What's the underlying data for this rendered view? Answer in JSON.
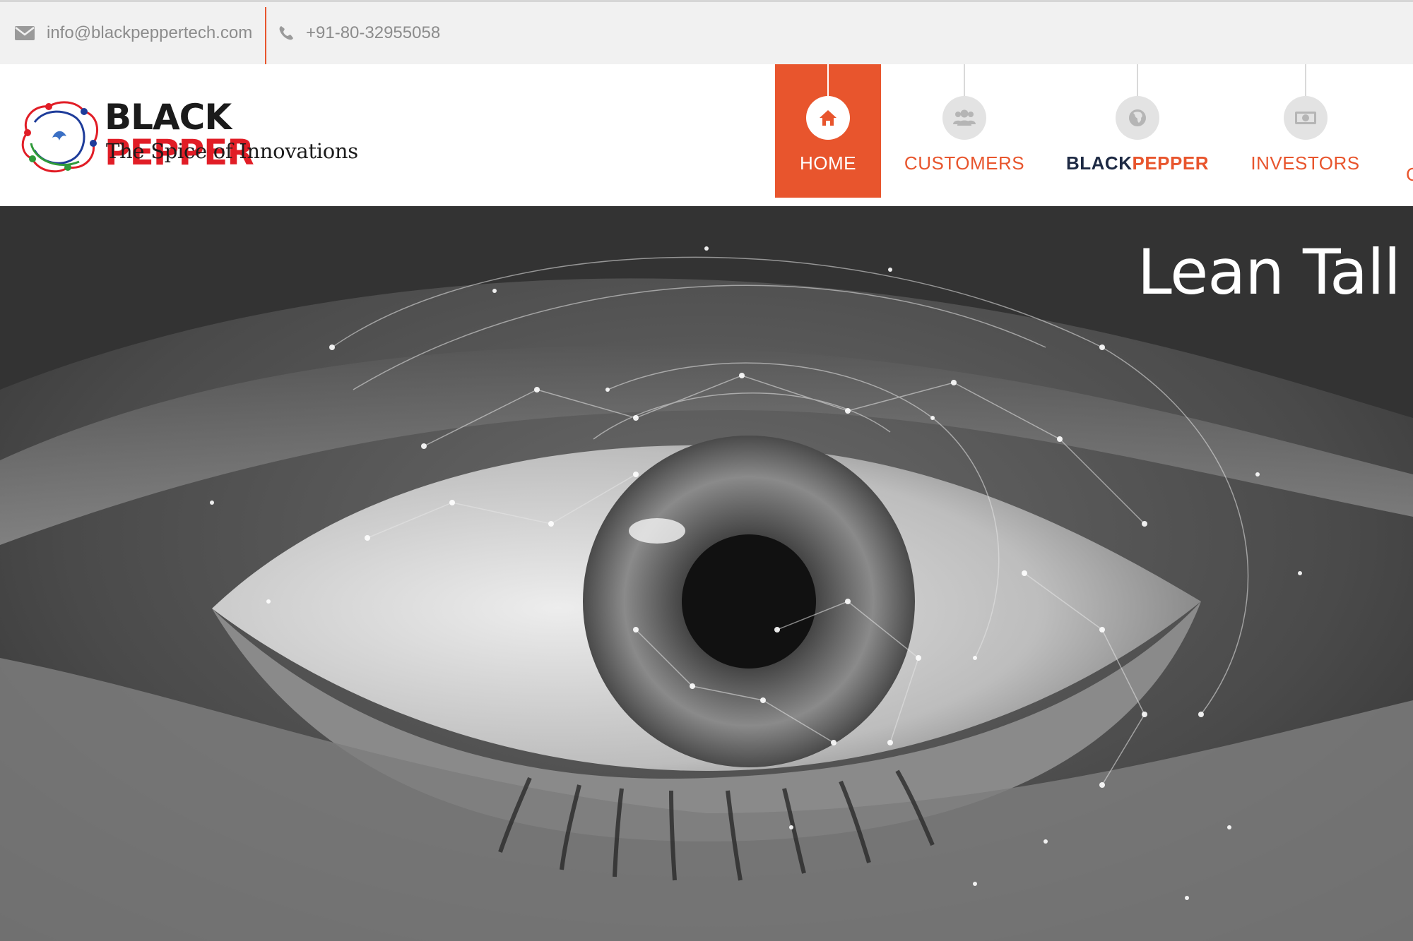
{
  "topbar": {
    "email": "info@blackpeppertech.com",
    "phone": "+91-80-32955058",
    "email_icon": "envelope-icon",
    "phone_icon": "phone-icon"
  },
  "logo": {
    "brand_black": "BLACK",
    "brand_red": "PEPPER",
    "tagline": "The Spice of Innovations"
  },
  "nav": {
    "items": [
      {
        "label": "HOME",
        "icon": "home-icon",
        "active": true
      },
      {
        "label": "CUSTOMERS",
        "icon": "users-icon",
        "active": false
      },
      {
        "label_dark": "BLACK",
        "label_accent": "PEPPER",
        "icon": "globe-icon",
        "active": false
      },
      {
        "label": "INVESTORS",
        "icon": "money-icon",
        "active": false
      }
    ]
  },
  "hero": {
    "title": "Lean Tall"
  },
  "colors": {
    "accent": "#e8552d",
    "brand_red": "#e11d26",
    "nav_dark": "#1e2a44",
    "topbar_bg": "#f1f1f1"
  }
}
